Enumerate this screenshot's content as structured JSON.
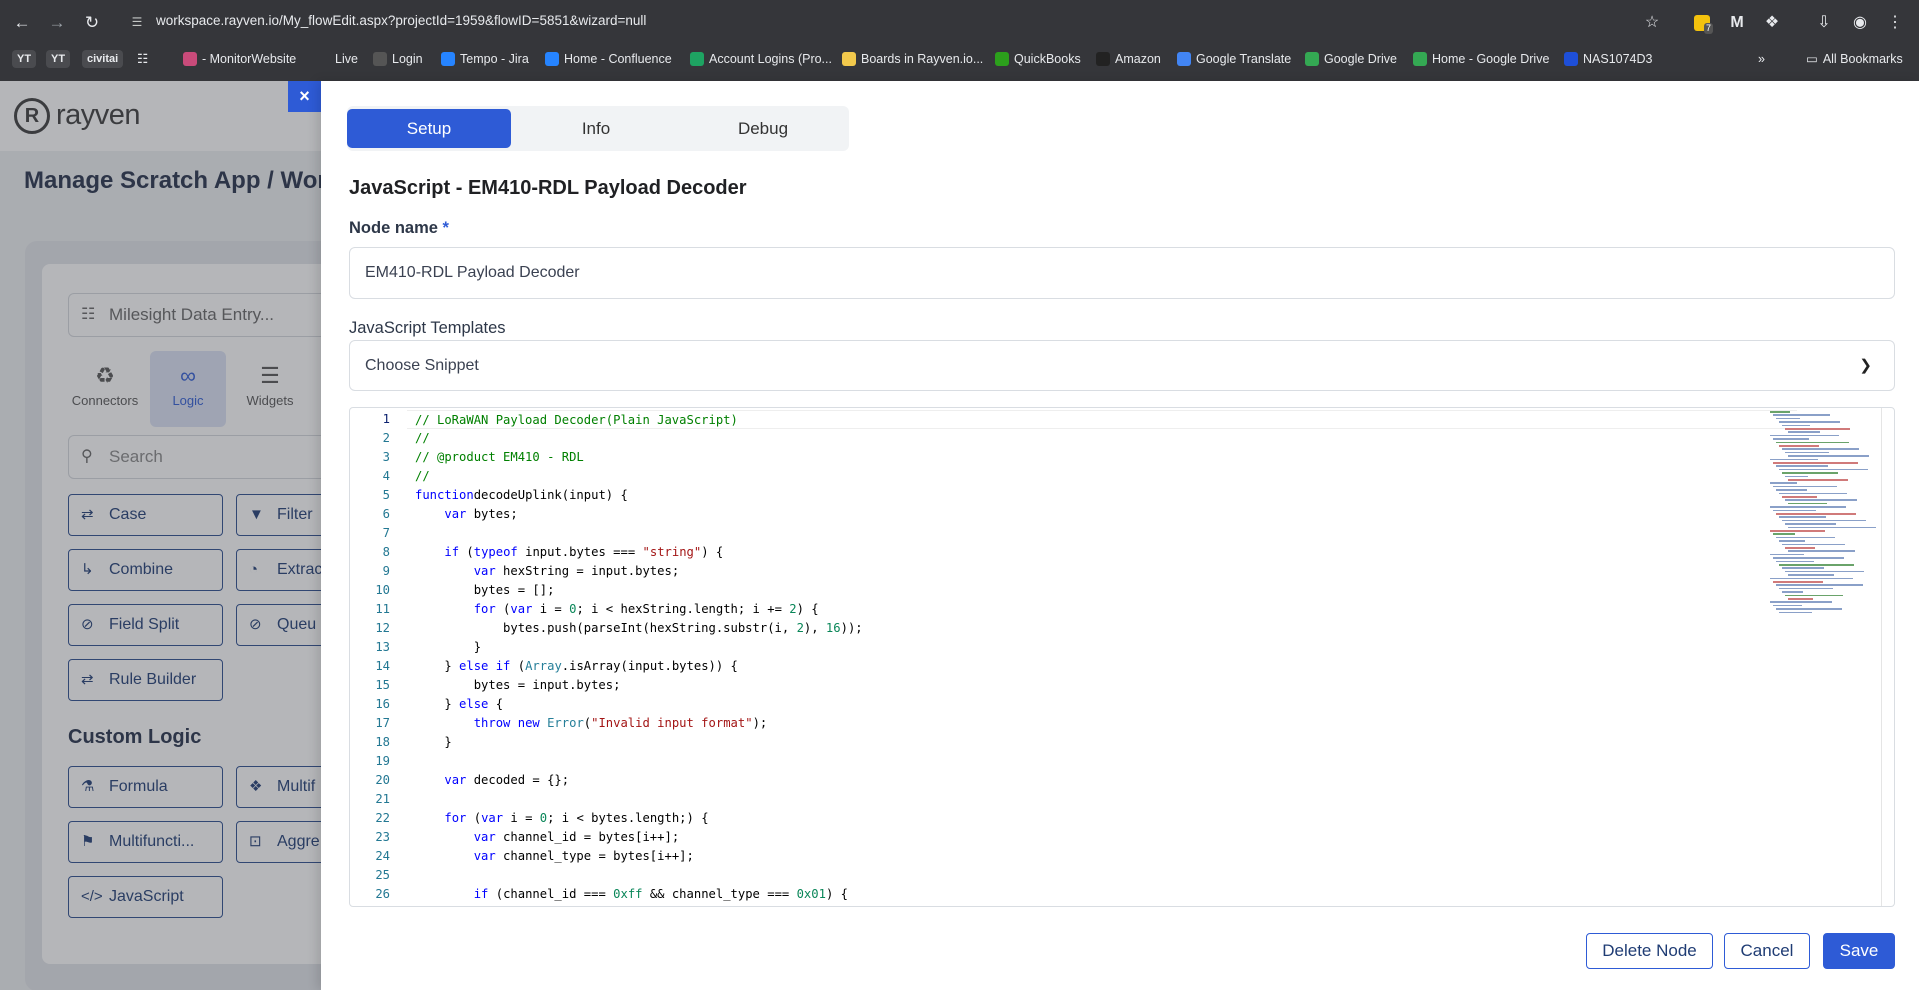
{
  "browser": {
    "url": "workspace.rayven.io/My_flowEdit.aspx?projectId=1959&flowID=5851&wizard=null",
    "bookmarks": [
      {
        "label": "YT",
        "type": "pill"
      },
      {
        "label": "YT",
        "type": "pill"
      },
      {
        "label": "civitai",
        "type": "pill"
      },
      {
        "label": "- MonitorWebsite",
        "icon_color": "#c94b7a"
      },
      {
        "label": "Live",
        "icon_color": ""
      },
      {
        "label": "Login",
        "icon_color": "#555555"
      },
      {
        "label": "Tempo - Jira",
        "icon_color": "#2684ff"
      },
      {
        "label": "Home - Confluence",
        "icon_color": "#2684ff"
      },
      {
        "label": "Account Logins (Pro...",
        "icon_color": "#1ea362"
      },
      {
        "label": "Boards in Rayven.io...",
        "icon_color": "#f2c94c"
      },
      {
        "label": "QuickBooks",
        "icon_color": "#2ca01c"
      },
      {
        "label": "Amazon",
        "icon_color": "#222222"
      },
      {
        "label": "Google Translate",
        "icon_color": "#4285f4"
      },
      {
        "label": "Google Drive",
        "icon_color": "#34a853"
      },
      {
        "label": "Home - Google Drive",
        "icon_color": "#34a853"
      },
      {
        "label": "NAS1074D3",
        "icon_color": "#1e4fd8"
      }
    ],
    "all_bookmarks": "All Bookmarks",
    "extension_badge": "7"
  },
  "background_app": {
    "logo_letter": "R",
    "logo_text": "rayven",
    "page_title": "Manage Scratch App / Work",
    "flow_selector": "Milesight Data Entry...",
    "tabs": [
      "Connectors",
      "Logic",
      "Widgets"
    ],
    "search_placeholder": "Search",
    "logic_buttons": [
      "Case",
      "Filter",
      "Combine",
      "Extrac",
      "Field Split",
      "Queu",
      "Rule Builder"
    ],
    "custom_logic_heading": "Custom Logic",
    "custom_buttons": [
      "Formula",
      "Multif",
      "Multifuncti...",
      "Aggre",
      "JavaScript"
    ]
  },
  "drawer": {
    "close_label": "×",
    "tabs": [
      {
        "label": "Setup",
        "active": true
      },
      {
        "label": "Info",
        "active": false
      },
      {
        "label": "Debug",
        "active": false
      }
    ],
    "heading": "JavaScript - EM410-RDL Payload Decoder",
    "node_name_label": "Node name",
    "required_mark": "*",
    "node_name_value": "EM410-RDL Payload Decoder",
    "templates_label": "JavaScript Templates",
    "snippet_value": "Choose Snippet",
    "buttons": {
      "delete": "Delete Node",
      "cancel": "Cancel",
      "save": "Save"
    }
  },
  "editor": {
    "current_line": 1,
    "lines": [
      [
        [
          "c-com",
          "// LoRaWAN Payload Decoder(Plain JavaScript)"
        ]
      ],
      [
        [
          "c-com",
          "//"
        ]
      ],
      [
        [
          "c-com",
          "// @product EM410 - RDL"
        ]
      ],
      [
        [
          "c-com",
          "//"
        ]
      ],
      [
        [
          "c-kw",
          "function"
        ],
        [
          "",
          "decodeUplink(input) {"
        ]
      ],
      [
        [
          "",
          "    "
        ],
        [
          "c-kw",
          "var"
        ],
        [
          "",
          " bytes;"
        ]
      ],
      [
        [
          "",
          ""
        ]
      ],
      [
        [
          "",
          "    "
        ],
        [
          "c-kw",
          "if"
        ],
        [
          "",
          " ("
        ],
        [
          "c-kw",
          "typeof"
        ],
        [
          "",
          " input.bytes === "
        ],
        [
          "c-str",
          "\"string\""
        ],
        [
          "",
          ") {"
        ]
      ],
      [
        [
          "",
          "        "
        ],
        [
          "c-kw",
          "var"
        ],
        [
          "",
          " hexString = input.bytes;"
        ]
      ],
      [
        [
          "",
          "        bytes = [];"
        ]
      ],
      [
        [
          "",
          "        "
        ],
        [
          "c-kw",
          "for"
        ],
        [
          "",
          " ("
        ],
        [
          "c-kw",
          "var"
        ],
        [
          "",
          " i = "
        ],
        [
          "c-num",
          "0"
        ],
        [
          "",
          "; i < hexString.length; i += "
        ],
        [
          "c-num",
          "2"
        ],
        [
          "",
          ") {"
        ]
      ],
      [
        [
          "",
          "            bytes.push(parseInt(hexString.substr(i, "
        ],
        [
          "c-num",
          "2"
        ],
        [
          "",
          "), "
        ],
        [
          "c-num",
          "16"
        ],
        [
          "",
          "));"
        ]
      ],
      [
        [
          "",
          "        }"
        ]
      ],
      [
        [
          "",
          "    } "
        ],
        [
          "c-kw",
          "else if"
        ],
        [
          "",
          " ("
        ],
        [
          "c-typ",
          "Array"
        ],
        [
          "",
          ".isArray(input.bytes)) {"
        ]
      ],
      [
        [
          "",
          "        bytes = input.bytes;"
        ]
      ],
      [
        [
          "",
          "    } "
        ],
        [
          "c-kw",
          "else"
        ],
        [
          "",
          " {"
        ]
      ],
      [
        [
          "",
          "        "
        ],
        [
          "c-kw",
          "throw new"
        ],
        [
          "",
          " "
        ],
        [
          "c-typ",
          "Error"
        ],
        [
          "",
          "("
        ],
        [
          "c-str",
          "\"Invalid input format\""
        ],
        [
          "",
          ");"
        ]
      ],
      [
        [
          "",
          "    }"
        ]
      ],
      [
        [
          "",
          ""
        ]
      ],
      [
        [
          "",
          "    "
        ],
        [
          "c-kw",
          "var"
        ],
        [
          "",
          " decoded = {};"
        ]
      ],
      [
        [
          "",
          ""
        ]
      ],
      [
        [
          "",
          "    "
        ],
        [
          "c-kw",
          "for"
        ],
        [
          "",
          " ("
        ],
        [
          "c-kw",
          "var"
        ],
        [
          "",
          " i = "
        ],
        [
          "c-num",
          "0"
        ],
        [
          "",
          "; i < bytes.length;) {"
        ]
      ],
      [
        [
          "",
          "        "
        ],
        [
          "c-kw",
          "var"
        ],
        [
          "",
          " channel_id = bytes[i++];"
        ]
      ],
      [
        [
          "",
          "        "
        ],
        [
          "c-kw",
          "var"
        ],
        [
          "",
          " channel_type = bytes[i++];"
        ]
      ],
      [
        [
          "",
          ""
        ]
      ],
      [
        [
          "",
          "        "
        ],
        [
          "c-kw",
          "if"
        ],
        [
          "",
          " (channel_id === "
        ],
        [
          "c-num",
          "0xff"
        ],
        [
          "",
          " && channel_type === "
        ],
        [
          "c-num",
          "0x01"
        ],
        [
          "",
          ") {"
        ]
      ]
    ]
  }
}
